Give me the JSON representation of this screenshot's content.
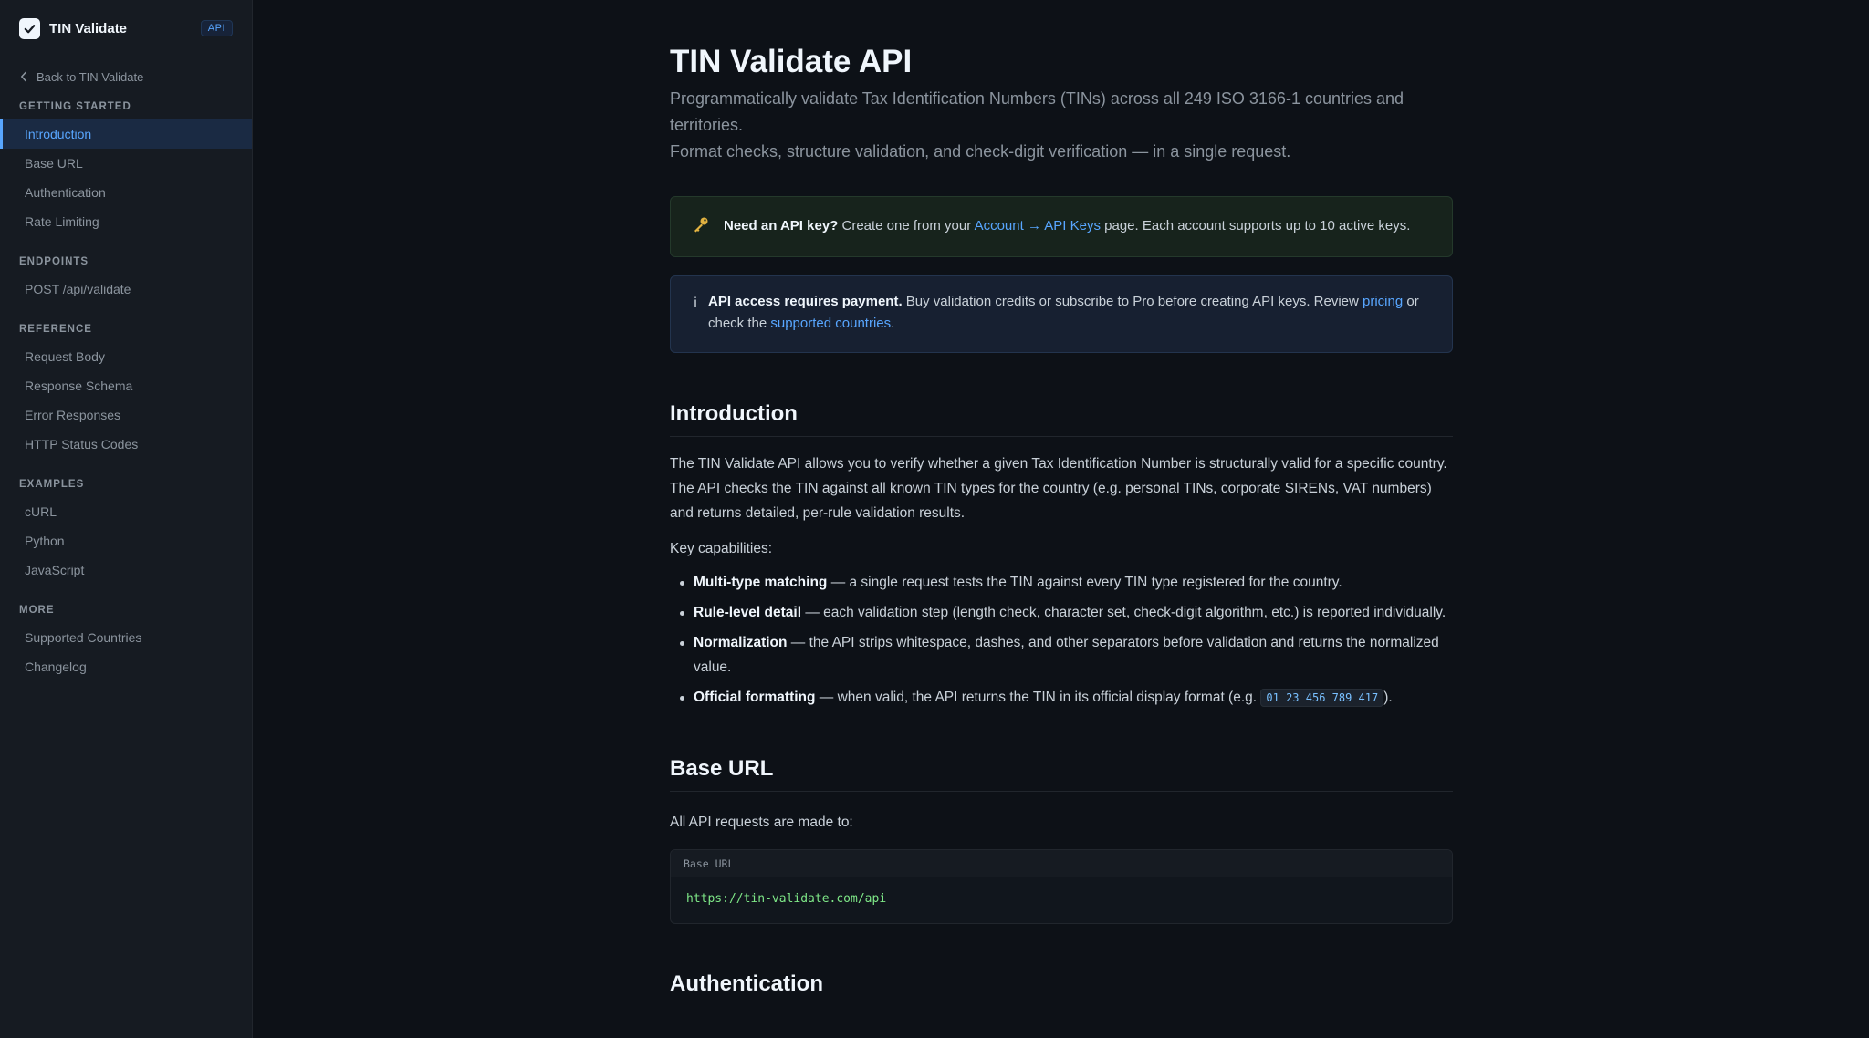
{
  "sidebar": {
    "brand": {
      "name": "TIN Validate",
      "badge": "API"
    },
    "back_label": "Back to TIN Validate",
    "sections": [
      {
        "heading": "GETTING STARTED",
        "items": [
          "Introduction",
          "Base URL",
          "Authentication",
          "Rate Limiting"
        ]
      },
      {
        "heading": "ENDPOINTS",
        "items": [
          "POST /api/validate"
        ]
      },
      {
        "heading": "REFERENCE",
        "items": [
          "Request Body",
          "Response Schema",
          "Error Responses",
          "HTTP Status Codes"
        ]
      },
      {
        "heading": "EXAMPLES",
        "items": [
          "cURL",
          "Python",
          "JavaScript"
        ]
      },
      {
        "heading": "MORE",
        "items": [
          "Supported Countries",
          "Changelog"
        ]
      }
    ],
    "active_item": "Introduction"
  },
  "main": {
    "title": "TIN Validate API",
    "lead_line1": "Programmatically validate Tax Identification Numbers (TINs) across all 249 ISO 3166-1 countries and territories.",
    "lead_line2": "Format checks, structure validation, and check-digit verification — in a single request.",
    "callout_key": {
      "bold": "Need an API key?",
      "text_before": " Create one from your ",
      "link": "Account → API Keys",
      "text_after": " page. Each account supports up to 10 active keys."
    },
    "callout_info": {
      "icon": "i",
      "bold": "API access requires payment.",
      "text_before": " Buy validation credits or subscribe to Pro before creating API keys. Review ",
      "link1": "pricing",
      "text_mid": " or check the ",
      "link2": "supported countries",
      "text_after": "."
    },
    "intro": {
      "heading": "Introduction",
      "paragraph": "The TIN Validate API allows you to verify whether a given Tax Identification Number is structurally valid for a specific country. The API checks the TIN against all known TIN types for the country (e.g. personal TINs, corporate SIRENs, VAT numbers) and returns detailed, per-rule validation results.",
      "caps_label": "Key capabilities:",
      "caps": [
        {
          "bold": "Multi-type matching",
          "text": " — a single request tests the TIN against every TIN type registered for the country."
        },
        {
          "bold": "Rule-level detail",
          "text": " — each validation step (length check, character set, check-digit algorithm, etc.) is reported individually."
        },
        {
          "bold": "Normalization",
          "text": " — the API strips whitespace, dashes, and other separators before validation and returns the normalized value."
        },
        {
          "bold": "Official formatting",
          "text": " — when valid, the API returns the TIN in its official display format (e.g. ",
          "code": "01 23 456 789 417",
          "text_after": ")."
        }
      ]
    },
    "base_url": {
      "heading": "Base URL",
      "paragraph": "All API requests are made to:",
      "code_label": "Base URL",
      "code": "https://tin-validate.com/api"
    },
    "auth": {
      "heading": "Authentication"
    }
  }
}
